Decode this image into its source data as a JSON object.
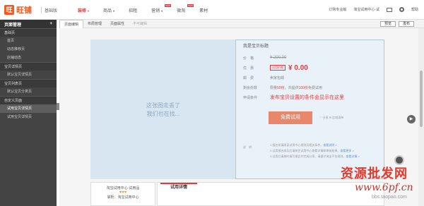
{
  "app": {
    "logo_glyph": "旺",
    "name": "旺铺",
    "edition": "基础版"
  },
  "nav": [
    {
      "label": "装修",
      "caret": "▾",
      "active": true
    },
    {
      "label": "商品",
      "caret": "▾"
    },
    {
      "label": "招租",
      "caret": ""
    },
    {
      "label": "营销",
      "caret": "▾",
      "badge": "NEW"
    },
    {
      "label": "微淘",
      "caret": "",
      "badge": "NEW"
    },
    {
      "label": "素材",
      "caret": ""
    }
  ],
  "top_right": {
    "order_service": "订购专业版",
    "shop_info": "淘宝试用中心-试",
    "help": "帮助"
  },
  "sidebar": {
    "title": "页面管理",
    "add": "+",
    "items": [
      {
        "type": "section",
        "label": "基础页"
      },
      {
        "type": "item",
        "label": "首页"
      },
      {
        "type": "item",
        "label": "动态推荐页"
      },
      {
        "type": "item",
        "label": "店铺动态"
      },
      {
        "type": "section",
        "label": "宝贝详情页"
      },
      {
        "type": "item",
        "label": "默认宝贝详情页"
      },
      {
        "type": "section",
        "label": "宝贝列表页"
      },
      {
        "type": "item",
        "label": "默认宝贝分类页"
      },
      {
        "type": "section",
        "label": "自定义页面"
      },
      {
        "type": "item",
        "label": "试用宝贝详情页",
        "active": true
      },
      {
        "type": "item",
        "label": "试用宝贝详情页"
      }
    ]
  },
  "toolbar": {
    "tabs": [
      {
        "label": "页面编辑",
        "active": true
      },
      {
        "label": "布局管理"
      },
      {
        "label": "页面属性"
      },
      {
        "label": "不可编辑",
        "disabled": true
      }
    ],
    "preview": "预览",
    "publish": "发布"
  },
  "image_area": {
    "line1": "这张图走丢了",
    "line2": "我们也在找..."
  },
  "item": {
    "title": "我是宝贝标题",
    "price_label": "价　格",
    "price_orig": "¥ 200.00",
    "trial_label": "优　惠",
    "trial_tag": "试用价格",
    "price_now": "¥ 0.00",
    "shipping_label": "邮　费",
    "shipping_value": "卖家包邮",
    "count_label": "剩余份数",
    "count_prefix": "限量",
    "count_value": "50份",
    "count_mid": "，共提供",
    "count_value2": "100份",
    "count_suffix": "免费试用",
    "conditions_label": "申请条件",
    "conditions_value": "发布宝贝设置的条件会显示在这里",
    "apply_button": "免费试用",
    "share": "♡ 分享  ✉ 比较清单"
  },
  "description": {
    "label": "说　明",
    "lines": [
      {
        "text": "1.报名前请阅读试用中心规则及相关条件。",
        "link": "查看说明 >"
      },
      {
        "text": "2.试用报名成功后请前往试用中心查看详情和审核结果。",
        "link": "查看更多 >"
      },
      {
        "text": "3.试用后请按时填写报告并完成分享。请遵守淘宝平台规则。",
        "link": "查看详情 >"
      }
    ]
  },
  "bottom": {
    "shop_name": "淘宝试用中心·试用品",
    "stars": "♥♥♥",
    "shop_contact": "掌柜：淘宝试用中心",
    "tab": "试用详情"
  },
  "float": {
    "play": "▶"
  },
  "watermark": {
    "line1": "资源批发网",
    "line2": "www.6pf.cn",
    "line3": "bbs.taopao.com"
  }
}
